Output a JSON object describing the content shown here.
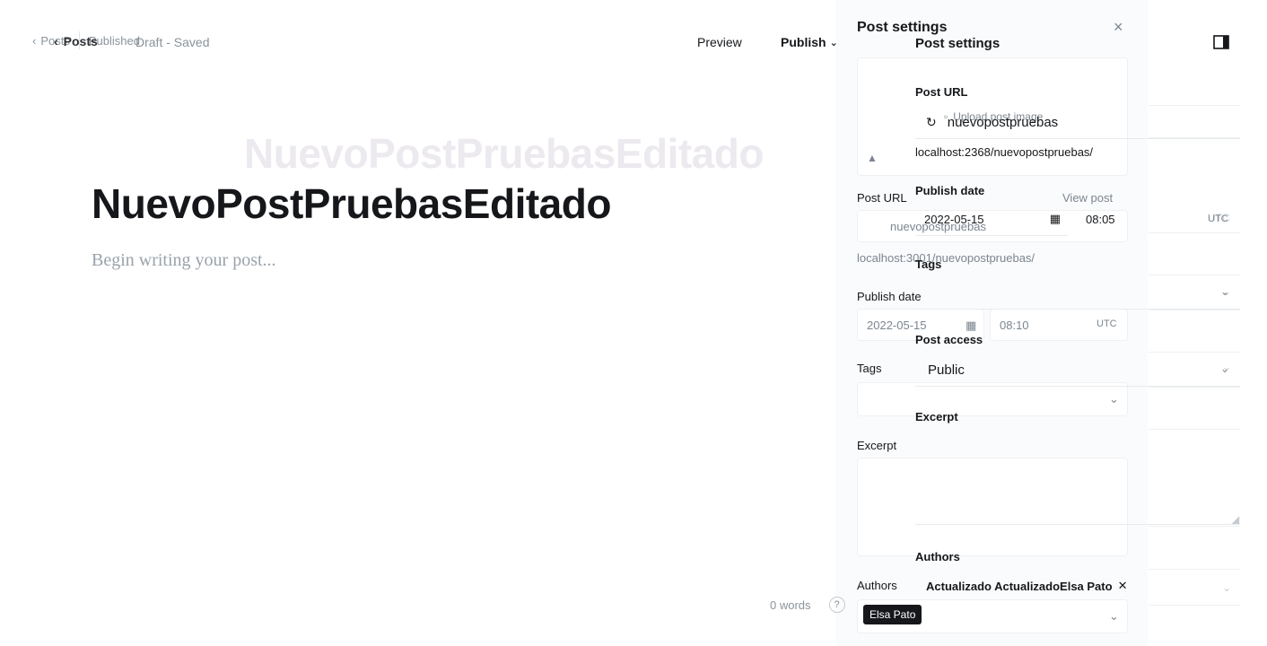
{
  "topbar_back": {
    "back_label": "Posts",
    "status": "Published"
  },
  "topbar": {
    "back_label": "Posts",
    "status": "Draft - Saved",
    "preview_label": "Preview",
    "publish_label": "Publish"
  },
  "editor": {
    "ghost_title": "NuevoPostPruebasEditado",
    "title": "NuevoPostPruebasEditado",
    "body_placeholder": "Begin writing your post...",
    "word_count": "0 words",
    "help_label": "?"
  },
  "back_settings": {
    "title": "Post settings",
    "close_label": "×",
    "upload_label": "Upload post image",
    "post_url_label": "Post URL",
    "view_post_label": "View post",
    "post_url_value": "nuevopostpruebas",
    "post_url_full": "localhost:3001/nuevopostpruebas/",
    "publish_date_label": "Publish date",
    "date_value": "2022-05-15",
    "time_value": "08:10",
    "timezone": "UTC",
    "tags_label": "Tags",
    "excerpt_label": "Excerpt",
    "authors_label": "Authors",
    "author_chip": "Elsa Pato"
  },
  "front_settings": {
    "title": "Post settings",
    "post_url_label": "Post URL",
    "post_url_value": "nuevopostpruebas",
    "post_url_full": "localhost:2368/nuevopostpruebas/",
    "publish_date_label": "Publish date",
    "date_value": "2022-05-15",
    "time_value": "08:05",
    "timezone": "UTC",
    "tags_label": "Tags",
    "access_label": "Post access",
    "access_value": "Public",
    "excerpt_label": "Excerpt",
    "authors_label": "Authors",
    "authors_value": "Actualizado ActualizadoElsa Pato",
    "author_remove": "✕"
  },
  "icons": {
    "back": "chevron-left-icon",
    "publish_caret": "chevron-down-icon",
    "settings_toggle": "sidebar-toggle-icon",
    "close": "close-icon",
    "calendar": "calendar-icon",
    "chevron": "chevron-down-icon",
    "image": "image-icon",
    "unsplash": "unsplash-icon"
  }
}
